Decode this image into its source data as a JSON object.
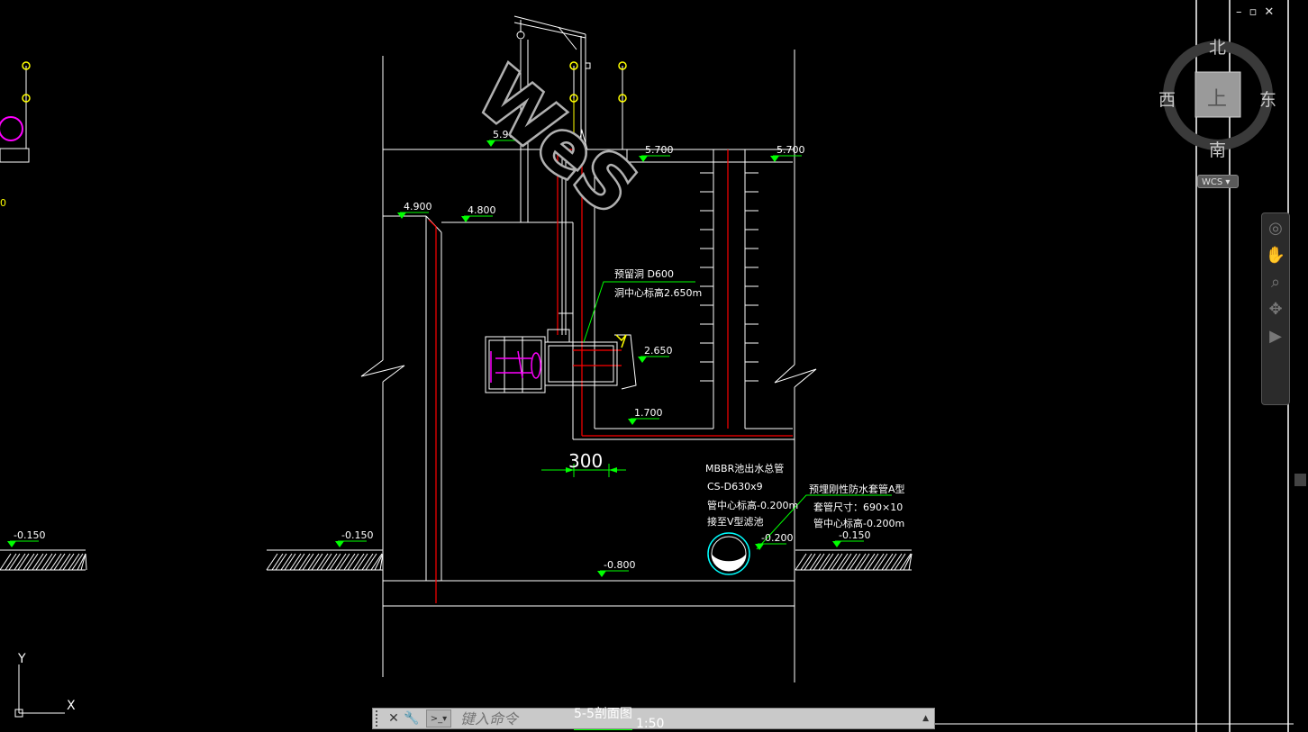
{
  "window": {
    "controls": [
      "–",
      "▫",
      "✕"
    ]
  },
  "viewcube": {
    "north": "北",
    "south": "南",
    "west": "西",
    "east": "东",
    "top": "上",
    "wcs": "WCS"
  },
  "drawing": {
    "elevations": {
      "e5900": "5.900",
      "e5700a": "5.700",
      "e5700b": "5.700",
      "e4900": "4.900",
      "e4800": "4.800",
      "e2650": "2.650",
      "e1700": "1.700",
      "e_neg0150_a": "-0.150",
      "e_neg0150_b": "-0.150",
      "e_neg0150_c": "-0.150",
      "e_neg0800": "-0.800",
      "e_neg0200": "-0.200",
      "left_partial": "0"
    },
    "notes": {
      "hole_line1": "预留洞 D600",
      "hole_line2": "洞中心标高2.650m",
      "pipe_line1": "MBBR池出水总管",
      "pipe_line2": "CS-D630x9",
      "pipe_line3": "管中心标高-0.200m",
      "pipe_line4": "接至V型滤池",
      "sleeve_line1": "预埋刚性防水套管A型",
      "sleeve_line2": "套管尺寸：690×10",
      "sleeve_line3": "管中心标高-0.200m"
    },
    "dimension": "300",
    "section_title": "5-5剖面图",
    "section_scale": "1:50",
    "watermark": "WeS"
  },
  "ucs": {
    "x_label": "X",
    "y_label": "Y"
  },
  "command_line": {
    "placeholder": "键入命令"
  },
  "colors": {
    "background": "#000000",
    "lines": "#ffffff",
    "red": "#ff0000",
    "green": "#00ff00",
    "yellow": "#ffff00",
    "magenta": "#ff00ff",
    "cyan": "#00ffff"
  }
}
